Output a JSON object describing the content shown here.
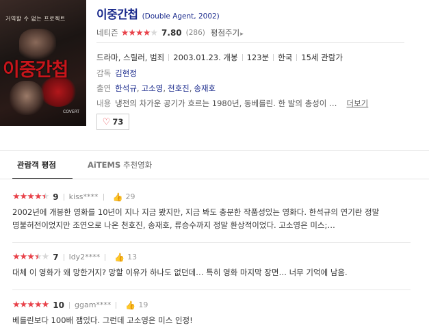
{
  "poster": {
    "tagline": "거역할 수 없는 프로젝트",
    "title": "이중간첩",
    "small_text": "COVERT"
  },
  "movie": {
    "title": "이중간첩",
    "subtitle": "(Double Agent, 2002)"
  },
  "rating": {
    "label": "네티즌",
    "stars_on": "★★★★",
    "stars_off": "★",
    "score": "7.80",
    "count": "(286)",
    "rate_label": "평점주기",
    "rate_caret": "▸"
  },
  "meta": {
    "genre": "드라마, 스릴러, 범죄",
    "release": "2003.01.23. 개봉",
    "runtime": "123분",
    "country": "한국",
    "grade": "15세 관람가",
    "director_label": "감독",
    "director": "김현정",
    "cast_label": "출연",
    "cast": [
      "한석규",
      "고소영",
      "천호진",
      "송재호"
    ],
    "summary_label": "내용",
    "summary": "냉전의 차가운 공기가 흐르는 1980년, 동베를린. 한 발의 총성이 …",
    "more_label": "더보기"
  },
  "likes": {
    "icon": "♡",
    "count": "73"
  },
  "tabs": {
    "active": "관람객 평점",
    "other_brand": "AiTEMS",
    "other_label": "추천영화"
  },
  "reviews": [
    {
      "stars_on": "★★★★",
      "stars_half": "★",
      "stars_off": "",
      "score": "9",
      "user": "kiss****",
      "votes": "29",
      "text": "2002년에 개봉한 영화를 10년이 지나 지금 봤지만, 지금 봐도 충분한 작품성있는 영화다. 한석규의 연기란 정말 명불허전이었지만 조연으로 나온 천호진, 송재호, 류승수까지 정말 환상적이었다. 고소영은 미스;…"
    },
    {
      "stars_on": "★★★",
      "stars_half": "★",
      "stars_off": "★",
      "score": "7",
      "user": "ldy2****",
      "votes": "13",
      "text": "대체 이 영화가 왜 망한거지? 망할 이유가 하나도 없던데… 특히 영화 마지막 장면… 너무 기억에 남음."
    },
    {
      "stars_on": "★★★★★",
      "stars_half": "",
      "stars_off": "",
      "score": "10",
      "user": "ggam****",
      "votes": "19",
      "text": "베를린보다 100배 잼있다. 그런데 고소영은 미스 인정!"
    }
  ],
  "colors": {
    "title_blue": "#1a2a8c",
    "star_red": "#e8424a",
    "poster_red": "#c7151b"
  }
}
